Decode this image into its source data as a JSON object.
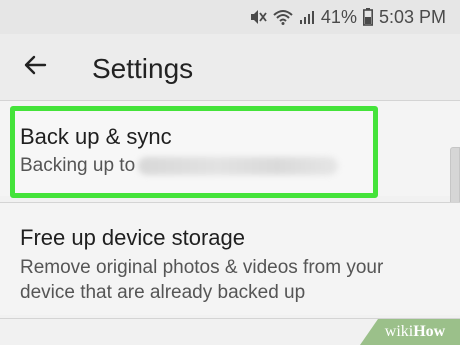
{
  "status_bar": {
    "battery": "41%",
    "time": "5:03 PM",
    "icons": [
      "mute-icon",
      "wifi-icon",
      "signal-icon",
      "battery-icon"
    ]
  },
  "app_bar": {
    "back_icon": "arrow-left-icon",
    "title": "Settings"
  },
  "settings": [
    {
      "title": "Back up & sync",
      "subtitle_prefix": "Backing up to",
      "highlighted": true
    },
    {
      "title": "Free up device storage",
      "subtitle": "Remove original photos & videos from your device that are already backed up"
    }
  ],
  "watermark": {
    "prefix": "wiki",
    "suffix": "How"
  },
  "colors": {
    "highlight": "#44e33a",
    "background": "#f1f1f1",
    "watermark_bg": "#9bc08a"
  }
}
